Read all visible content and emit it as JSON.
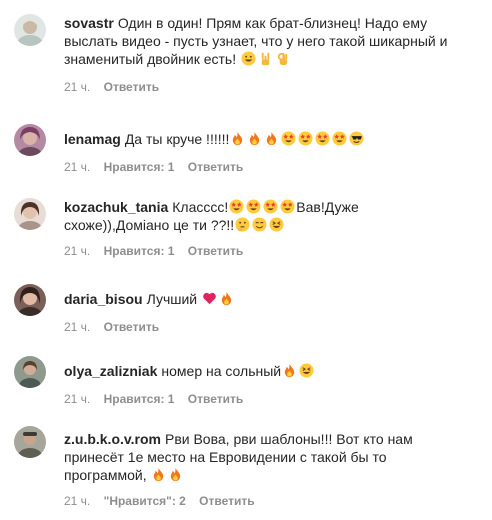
{
  "comments": [
    {
      "username": "sovastr",
      "text": "Один в один! Прям как брат-близнец! Надо ему выслать видео - пусть узнает, что у него такой шикарный и знаменитый двойник есть!",
      "emojis": [
        "grin",
        "rock-hand",
        "ok-hand"
      ],
      "time": "21 ч.",
      "likes": "",
      "reply": "Ответить",
      "avatar_color": "#c9d3cf"
    },
    {
      "username": "lenamag",
      "text": "Да ты круче !!!!!!",
      "emojis": [
        "fire",
        "fire",
        "fire",
        "star-struck",
        "star-struck",
        "star-struck",
        "star-struck",
        "sunglasses"
      ],
      "time": "21 ч.",
      "likes": "Нравится: 1",
      "reply": "Ответить",
      "avatar_color": "#9a6a86"
    },
    {
      "username": "kozachuk_tania",
      "text": "Класссс!",
      "text2": "Вав!Дуже схоже)),Доміано це ти ??!!",
      "emojis_a": [
        "star-struck",
        "star-struck",
        "star-struck",
        "star-struck"
      ],
      "emojis_b": [
        "thinking",
        "smile",
        "laugh"
      ],
      "time": "21 ч.",
      "likes": "Нравится: 1",
      "reply": "Ответить",
      "avatar_color": "#b8a49a"
    },
    {
      "username": "daria_bisou",
      "text": "Лучший",
      "emojis": [
        "heart",
        "fire"
      ],
      "time": "21 ч.",
      "likes": "",
      "reply": "Ответить",
      "avatar_color": "#5e4a44"
    },
    {
      "username": "olya_zalizniak",
      "text": "номер на сольный",
      "emojis": [
        "fire",
        "laugh"
      ],
      "time": "21 ч.",
      "likes": "Нравится: 1",
      "reply": "Ответить",
      "avatar_color": "#6f7a72"
    },
    {
      "username": "z.u.b.k.o.v.rom",
      "text": "Рви Вова, рви шаблоны!!! Вот кто нам принесёт 1е место на Евровидении с такой бы то программой,",
      "emojis": [
        "fire",
        "fire"
      ],
      "time": "21 ч.",
      "likes": "\"Нравится\": 2",
      "reply": "Ответить",
      "avatar_color": "#8a8a7e"
    }
  ],
  "emoji_colors": {
    "fire_outer": "#f2761d",
    "fire_inner": "#ffcf3a",
    "face": "#ffcb3d",
    "heart": "#e0245e",
    "star": "#e8412c"
  }
}
